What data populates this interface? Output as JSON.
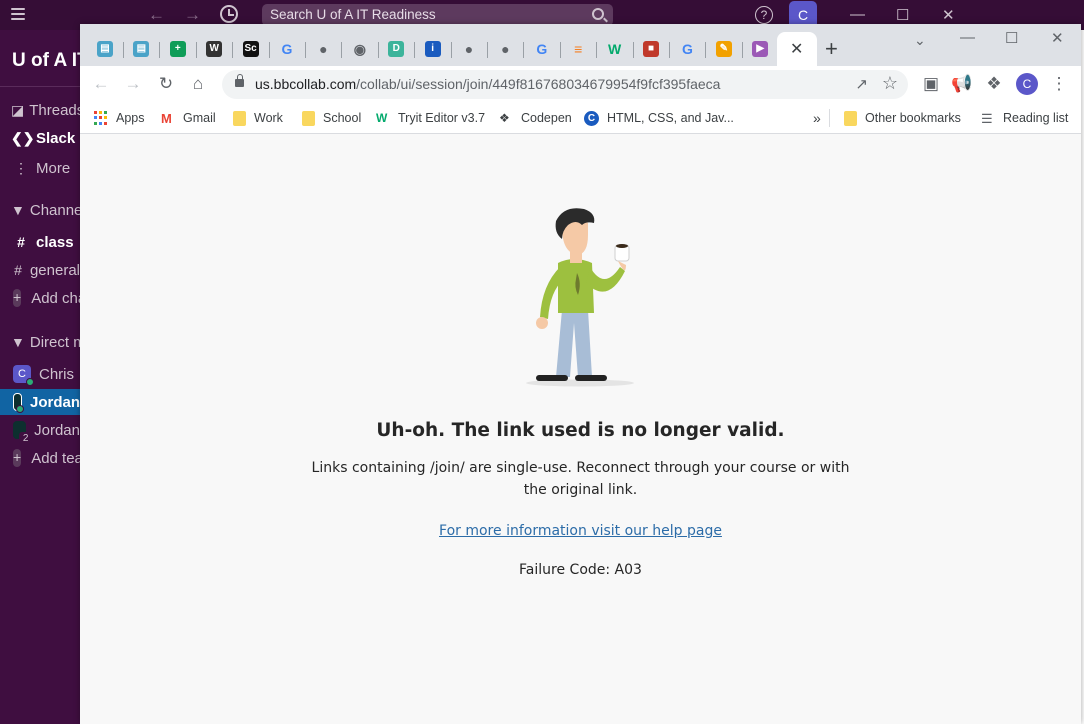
{
  "slack": {
    "search_placeholder": "Search U of A IT Readiness",
    "workspace_name": "U of A IT",
    "avatar_initial": "C",
    "sidebar": {
      "threads": "Threads",
      "slack_connect": "Slack Connect",
      "more": "More",
      "channels_header": "Channels",
      "channels": [
        "class",
        "general"
      ],
      "add_channel": "Add channels",
      "dms_header": "Direct messages",
      "dms": [
        {
          "name": "Chris",
          "initial": "C",
          "badge": ""
        },
        {
          "name": "Jordan",
          "initial": "",
          "badge": ""
        },
        {
          "name": "Jordan",
          "initial": "",
          "badge": "2"
        }
      ],
      "add_teammates": "Add teammates"
    }
  },
  "browser": {
    "tabs": [
      {
        "icon": "open-book-icon",
        "color": "#4aa3c8"
      },
      {
        "icon": "open-book-icon",
        "color": "#4aa3c8"
      },
      {
        "icon": "sheets-icon",
        "color": "#0f9d58"
      },
      {
        "icon": "wikipedia-icon",
        "color": "#333333"
      },
      {
        "icon": "sc-icon",
        "color": "#111111"
      },
      {
        "icon": "google-icon",
        "color": "#4285f4"
      },
      {
        "icon": "globe-icon",
        "color": "#5f6368"
      },
      {
        "icon": "chrome-icon",
        "color": "#5f6368"
      },
      {
        "icon": "d-icon",
        "color": "#3cb49b"
      },
      {
        "icon": "info-icon",
        "color": "#1a5bbf"
      },
      {
        "icon": "globe-icon",
        "color": "#5f6368"
      },
      {
        "icon": "globe-icon",
        "color": "#5f6368"
      },
      {
        "icon": "google-icon",
        "color": "#4285f4"
      },
      {
        "icon": "stackoverflow-icon",
        "color": "#f48024"
      },
      {
        "icon": "w3schools-icon",
        "color": "#04aa6d"
      },
      {
        "icon": "robot-icon",
        "color": "#c0392b"
      },
      {
        "icon": "google-icon",
        "color": "#4285f4"
      },
      {
        "icon": "pencil-icon",
        "color": "#f2a100"
      },
      {
        "icon": "play-icon",
        "color": "#9b59b6"
      }
    ],
    "url_host": "us.bbcollab.com",
    "url_path": "/collab/ui/session/join/449f816768034679954f9fcf395faeca",
    "profile_initial": "C",
    "bookmarks": [
      {
        "label": "Apps",
        "icon": "apps-icon"
      },
      {
        "label": "Gmail",
        "icon": "gmail-icon"
      },
      {
        "label": "Work",
        "icon": "folder-icon"
      },
      {
        "label": "School",
        "icon": "folder-icon"
      },
      {
        "label": "Tryit Editor v3.7",
        "icon": "w3schools-icon"
      },
      {
        "label": "Codepen",
        "icon": "codepen-icon"
      },
      {
        "label": "HTML, CSS, and Jav...",
        "icon": "c-icon"
      }
    ],
    "more_bookmarks": "»",
    "other_bookmarks": "Other bookmarks",
    "reading_list": "Reading list"
  },
  "page": {
    "title": "Uh-oh. The link used is no longer valid.",
    "description": "Links containing /join/ are single-use. Reconnect through your course or with the original link.",
    "help_link": "For more information visit our help page",
    "failure_code": "Failure Code: A03"
  }
}
